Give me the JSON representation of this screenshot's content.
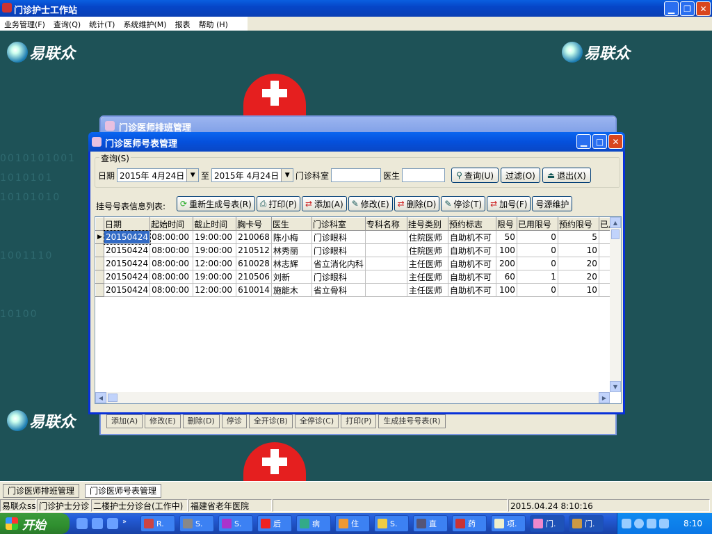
{
  "app": {
    "title": "门诊护士工作站"
  },
  "menu": [
    "业务管理(F)",
    "查询(Q)",
    "统计(T)",
    "系统维护(M)",
    "报表",
    "帮助 (H)"
  ],
  "brand": {
    "logo_text": "易联众"
  },
  "desktop": {
    "bg_digits": "0010101001\n1010101\n10101010\n\n\n1001110\n\n\n10100"
  },
  "back_window": {
    "title": "门诊医师排班管理",
    "toolbar": [
      "添加(A)",
      "修改(E)",
      "删除(D)",
      "停诊",
      "全开诊(B)",
      "全停诊(C)",
      "打印(P)",
      "生成挂号号表(R)"
    ]
  },
  "window": {
    "title": "门诊医师号表管理",
    "query": {
      "group_label": "查询(S)",
      "date_label": "日期",
      "date_from": "2015年 4月24日",
      "to_label": "至",
      "date_to": "2015年 4月24日",
      "dept_label": "门诊科室",
      "dept_value": "",
      "doctor_label": "医生",
      "doctor_value": "",
      "search_btn": "查询(U)",
      "filter_btn": "过滤(O)",
      "exit_btn": "退出(X)"
    },
    "list_label": "挂号号表信息列表:",
    "toolbar": {
      "regen": "重新生成号表(R)",
      "print": "打印(P)",
      "add": "添加(A)",
      "edit": "修改(E)",
      "delete": "删除(D)",
      "stop": "停诊(T)",
      "addnum": "加号(F)",
      "source": "号源维护"
    },
    "grid": {
      "columns": [
        "日期",
        "起始时间",
        "截止时间",
        "胸卡号",
        "医生",
        "门诊科室",
        "专科名称",
        "挂号类别",
        "预约标志",
        "限号",
        "已用限号",
        "预约限号",
        "已月"
      ],
      "rows": [
        [
          "20150424",
          "08:00:00",
          "19:00:00",
          "210068",
          "陈小梅",
          "门诊眼科",
          "",
          "住院医师",
          "自助机不可",
          "50",
          "0",
          "5"
        ],
        [
          "20150424",
          "08:00:00",
          "19:00:00",
          "210512",
          "林秀丽",
          "门诊眼科",
          "",
          "住院医师",
          "自助机不可",
          "100",
          "0",
          "10"
        ],
        [
          "20150424",
          "08:00:00",
          "12:00:00",
          "610028",
          "林志辉",
          "省立消化内科",
          "",
          "主任医师",
          "自助机不可",
          "200",
          "0",
          "20"
        ],
        [
          "20150424",
          "08:00:00",
          "19:00:00",
          "210506",
          "刘新",
          "门诊眼科",
          "",
          "主任医师",
          "自助机不可",
          "60",
          "1",
          "20"
        ],
        [
          "20150424",
          "08:00:00",
          "12:00:00",
          "610014",
          "施能木",
          "省立骨科",
          "",
          "主任医师",
          "自助机不可",
          "100",
          "0",
          "10"
        ]
      ]
    }
  },
  "bottom_tabs": [
    "门诊医师排班管理",
    "门诊医师号表管理"
  ],
  "status": [
    "易联众ss",
    "门诊护士分诊",
    "二楼护士分诊台(工作中)",
    "福建省老年医院",
    "",
    "2015.04.24 8:10:16"
  ],
  "taskbar": {
    "start": "开始",
    "tasks": [
      "R.",
      "S.",
      "S.",
      "后",
      "病",
      "住",
      "S.",
      "直",
      "药",
      "项.",
      "门.",
      "门."
    ],
    "clock": "8:10"
  }
}
